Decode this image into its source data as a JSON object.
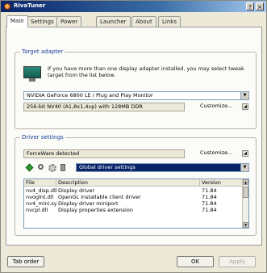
{
  "window": {
    "title": "RivaTuner",
    "help_glyph": "?",
    "close_glyph": "×"
  },
  "tabs": [
    {
      "label": "Main"
    },
    {
      "label": "Settings"
    },
    {
      "label": "Power user"
    },
    {
      "label": "Launcher"
    },
    {
      "label": "About"
    },
    {
      "label": "Links"
    }
  ],
  "target_adapter": {
    "group_title": "Target adapter",
    "info_text": "If you have more than one display adapter installed, you may select tweak target from the list below.",
    "adapter_select": "NVIDIA GeForce 6800 LE / Plug and Play Monitor",
    "adapter_details": "256-bit NV40 (A1,8x1,4vp) with 128MB DDR",
    "customize_label": "Customize..."
  },
  "driver_settings": {
    "group_title": "Driver settings",
    "driver_field": "ForceWare detected",
    "customize_label": "Customize...",
    "profile_select": "Global driver settings",
    "icons": [
      "add-icon",
      "search-icon",
      "settings-icon",
      "delete-icon"
    ],
    "columns": [
      "File",
      "Description",
      "Version"
    ],
    "files": [
      {
        "file": "nv4_disp.dll",
        "description": "Display driver",
        "version": "71.84"
      },
      {
        "file": "nvoglnt.dll",
        "description": "OpenGL installable client driver",
        "version": "71.84"
      },
      {
        "file": "nv4_mini.sys",
        "description": "Display driver miniport",
        "version": "71.84"
      },
      {
        "file": "nvcpl.dll",
        "description": "Display properties extension",
        "version": "71.84"
      }
    ]
  },
  "buttons": {
    "tab_order": "Tab order",
    "ok": "OK",
    "apply": "Apply"
  }
}
